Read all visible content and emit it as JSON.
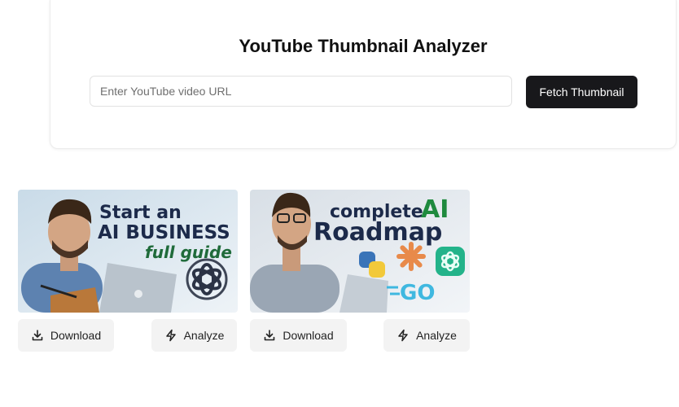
{
  "header": {
    "title": "YouTube Thumbnail Analyzer"
  },
  "search": {
    "placeholder": "Enter YouTube video URL",
    "value": "",
    "button_label": "Fetch Thumbnail"
  },
  "thumbnails": [
    {
      "text_lines": [
        "Start an",
        "AI BUSINESS",
        "full guide"
      ],
      "logo_icon": "openai-logo",
      "download_label": "Download",
      "download_icon": "download-icon",
      "analyze_label": "Analyze",
      "analyze_icon": "lightning-icon"
    },
    {
      "text_lines": [
        "complete",
        "AI",
        "Roadmap"
      ],
      "logo_icons": [
        "python-logo",
        "claude-logo",
        "openai-logo",
        "go-logo"
      ],
      "logo_text": "GO",
      "download_label": "Download",
      "download_icon": "download-icon",
      "analyze_label": "Analyze",
      "analyze_icon": "lightning-icon"
    }
  ],
  "colors": {
    "primary_button": "#18181b",
    "secondary_button": "#f3f3f3",
    "thumb1_green": "#1f6b3a",
    "thumb2_green": "#1f8a3e"
  }
}
